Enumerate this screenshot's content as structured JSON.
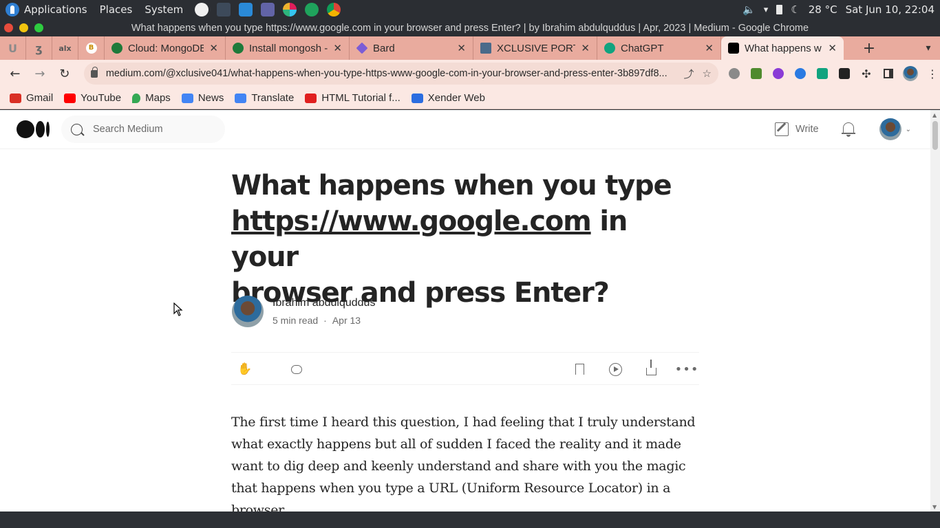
{
  "os_bar": {
    "menus": [
      "Applications",
      "Places",
      "System"
    ],
    "temperature": "28 °C",
    "datetime": "Sat Jun 10, 22:04"
  },
  "window": {
    "title": "What happens when you type https://www.google.com in your browser and press Enter? | by Ibrahim abdulquddus | Apr, 2023 | Medium - Google Chrome"
  },
  "tabs": [
    {
      "label": "Cloud: MongoDB",
      "color": "#1e7a3a"
    },
    {
      "label": "Install mongosh -",
      "color": "#1e7a3a"
    },
    {
      "label": "Bard",
      "color": "#7b5cd6"
    },
    {
      "label": "XCLUSIVE PORT",
      "color": "#4a6a8a"
    },
    {
      "label": "ChatGPT",
      "color": "#10a37f"
    },
    {
      "label": "What happens w",
      "color": "#000000",
      "active": true
    }
  ],
  "address_bar": {
    "url": "medium.com/@xclusive041/what-happens-when-you-type-https-www-google-com-in-your-browser-and-press-enter-3b897df8..."
  },
  "bookmarks": [
    {
      "label": "Gmail",
      "color": "#d93025"
    },
    {
      "label": "YouTube",
      "color": "#ff0000"
    },
    {
      "label": "Maps",
      "color": "#34a853"
    },
    {
      "label": "News",
      "color": "#4285f4"
    },
    {
      "label": "Translate",
      "color": "#4285f4"
    },
    {
      "label": "HTML Tutorial f...",
      "color": "#e02020"
    },
    {
      "label": "Xender Web",
      "color": "#2b6de0"
    }
  ],
  "medium": {
    "search_placeholder": "Search Medium",
    "write_label": "Write"
  },
  "article": {
    "title_line1": "What happens when you type",
    "title_link": "https://www.google.com",
    "title_rest1": " in your",
    "title_line3": "browser and press Enter?",
    "author": "Ibrahim abdulquddus",
    "read_time": "5 min read",
    "date": "Apr 13",
    "body": "The first time I heard this question, I had feeling that I truly understand what exactly happens but all of sudden I faced the reality and it made want to dig deep and keenly understand and share with you the magic that happens when you type a URL (Uniform Resource Locator) in a browser."
  }
}
